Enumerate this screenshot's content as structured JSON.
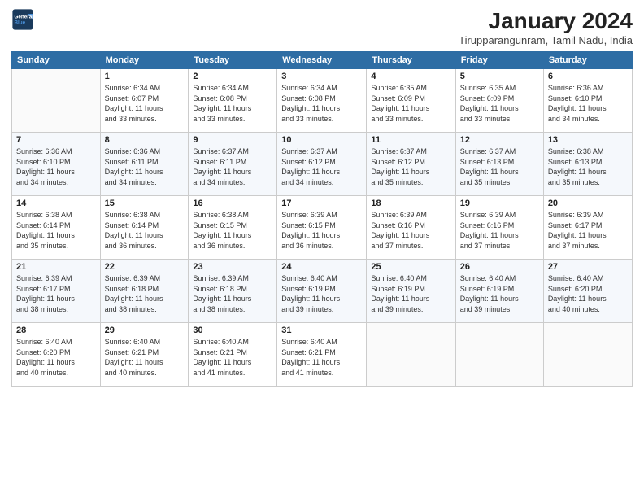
{
  "header": {
    "logo_line1": "General",
    "logo_line2": "Blue",
    "month_title": "January 2024",
    "location": "Tirupparangunram, Tamil Nadu, India"
  },
  "days_of_week": [
    "Sunday",
    "Monday",
    "Tuesday",
    "Wednesday",
    "Thursday",
    "Friday",
    "Saturday"
  ],
  "weeks": [
    [
      {
        "num": "",
        "text": ""
      },
      {
        "num": "1",
        "text": "Sunrise: 6:34 AM\nSunset: 6:07 PM\nDaylight: 11 hours\nand 33 minutes."
      },
      {
        "num": "2",
        "text": "Sunrise: 6:34 AM\nSunset: 6:08 PM\nDaylight: 11 hours\nand 33 minutes."
      },
      {
        "num": "3",
        "text": "Sunrise: 6:34 AM\nSunset: 6:08 PM\nDaylight: 11 hours\nand 33 minutes."
      },
      {
        "num": "4",
        "text": "Sunrise: 6:35 AM\nSunset: 6:09 PM\nDaylight: 11 hours\nand 33 minutes."
      },
      {
        "num": "5",
        "text": "Sunrise: 6:35 AM\nSunset: 6:09 PM\nDaylight: 11 hours\nand 33 minutes."
      },
      {
        "num": "6",
        "text": "Sunrise: 6:36 AM\nSunset: 6:10 PM\nDaylight: 11 hours\nand 34 minutes."
      }
    ],
    [
      {
        "num": "7",
        "text": "Sunrise: 6:36 AM\nSunset: 6:10 PM\nDaylight: 11 hours\nand 34 minutes."
      },
      {
        "num": "8",
        "text": "Sunrise: 6:36 AM\nSunset: 6:11 PM\nDaylight: 11 hours\nand 34 minutes."
      },
      {
        "num": "9",
        "text": "Sunrise: 6:37 AM\nSunset: 6:11 PM\nDaylight: 11 hours\nand 34 minutes."
      },
      {
        "num": "10",
        "text": "Sunrise: 6:37 AM\nSunset: 6:12 PM\nDaylight: 11 hours\nand 34 minutes."
      },
      {
        "num": "11",
        "text": "Sunrise: 6:37 AM\nSunset: 6:12 PM\nDaylight: 11 hours\nand 35 minutes."
      },
      {
        "num": "12",
        "text": "Sunrise: 6:37 AM\nSunset: 6:13 PM\nDaylight: 11 hours\nand 35 minutes."
      },
      {
        "num": "13",
        "text": "Sunrise: 6:38 AM\nSunset: 6:13 PM\nDaylight: 11 hours\nand 35 minutes."
      }
    ],
    [
      {
        "num": "14",
        "text": "Sunrise: 6:38 AM\nSunset: 6:14 PM\nDaylight: 11 hours\nand 35 minutes."
      },
      {
        "num": "15",
        "text": "Sunrise: 6:38 AM\nSunset: 6:14 PM\nDaylight: 11 hours\nand 36 minutes."
      },
      {
        "num": "16",
        "text": "Sunrise: 6:38 AM\nSunset: 6:15 PM\nDaylight: 11 hours\nand 36 minutes."
      },
      {
        "num": "17",
        "text": "Sunrise: 6:39 AM\nSunset: 6:15 PM\nDaylight: 11 hours\nand 36 minutes."
      },
      {
        "num": "18",
        "text": "Sunrise: 6:39 AM\nSunset: 6:16 PM\nDaylight: 11 hours\nand 37 minutes."
      },
      {
        "num": "19",
        "text": "Sunrise: 6:39 AM\nSunset: 6:16 PM\nDaylight: 11 hours\nand 37 minutes."
      },
      {
        "num": "20",
        "text": "Sunrise: 6:39 AM\nSunset: 6:17 PM\nDaylight: 11 hours\nand 37 minutes."
      }
    ],
    [
      {
        "num": "21",
        "text": "Sunrise: 6:39 AM\nSunset: 6:17 PM\nDaylight: 11 hours\nand 38 minutes."
      },
      {
        "num": "22",
        "text": "Sunrise: 6:39 AM\nSunset: 6:18 PM\nDaylight: 11 hours\nand 38 minutes."
      },
      {
        "num": "23",
        "text": "Sunrise: 6:39 AM\nSunset: 6:18 PM\nDaylight: 11 hours\nand 38 minutes."
      },
      {
        "num": "24",
        "text": "Sunrise: 6:40 AM\nSunset: 6:19 PM\nDaylight: 11 hours\nand 39 minutes."
      },
      {
        "num": "25",
        "text": "Sunrise: 6:40 AM\nSunset: 6:19 PM\nDaylight: 11 hours\nand 39 minutes."
      },
      {
        "num": "26",
        "text": "Sunrise: 6:40 AM\nSunset: 6:19 PM\nDaylight: 11 hours\nand 39 minutes."
      },
      {
        "num": "27",
        "text": "Sunrise: 6:40 AM\nSunset: 6:20 PM\nDaylight: 11 hours\nand 40 minutes."
      }
    ],
    [
      {
        "num": "28",
        "text": "Sunrise: 6:40 AM\nSunset: 6:20 PM\nDaylight: 11 hours\nand 40 minutes."
      },
      {
        "num": "29",
        "text": "Sunrise: 6:40 AM\nSunset: 6:21 PM\nDaylight: 11 hours\nand 40 minutes."
      },
      {
        "num": "30",
        "text": "Sunrise: 6:40 AM\nSunset: 6:21 PM\nDaylight: 11 hours\nand 41 minutes."
      },
      {
        "num": "31",
        "text": "Sunrise: 6:40 AM\nSunset: 6:21 PM\nDaylight: 11 hours\nand 41 minutes."
      },
      {
        "num": "",
        "text": ""
      },
      {
        "num": "",
        "text": ""
      },
      {
        "num": "",
        "text": ""
      }
    ]
  ]
}
